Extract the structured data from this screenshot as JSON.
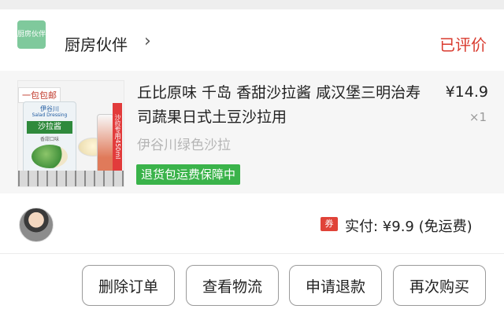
{
  "shop": {
    "logo_text": "厨房伙伴",
    "name": "厨房伙伴",
    "chevron": "›"
  },
  "order": {
    "status": "已评价"
  },
  "product": {
    "image": {
      "promo_tag": "一包包邮",
      "brand": "伊谷川",
      "brand_en": "Salad Dressing",
      "label": "沙拉酱",
      "sub_label": "香甜口味",
      "side_text": "沙拉专用450ml",
      "icon": "product-photo"
    },
    "title": "丘比原味 千岛 香甜沙拉酱 咸汉堡三明治寿司蔬果日式土豆沙拉用",
    "price": "¥14.9",
    "quantity": "×1",
    "shop_line": "伊谷川绿色沙拉",
    "guarantee": "退货包运费保障中"
  },
  "payment": {
    "coupon_badge": "券",
    "paid": "实付: ¥9.9 (免运费)"
  },
  "actions": {
    "delete": "删除订单",
    "logistics": "查看物流",
    "refund": "申请退款",
    "rebuy": "再次购买"
  },
  "colors": {
    "status_red": "#d93a2e",
    "guarantee_green": "#3ab34a",
    "shop_logo_green": "#7fc99c",
    "coupon_red": "#e04338"
  }
}
